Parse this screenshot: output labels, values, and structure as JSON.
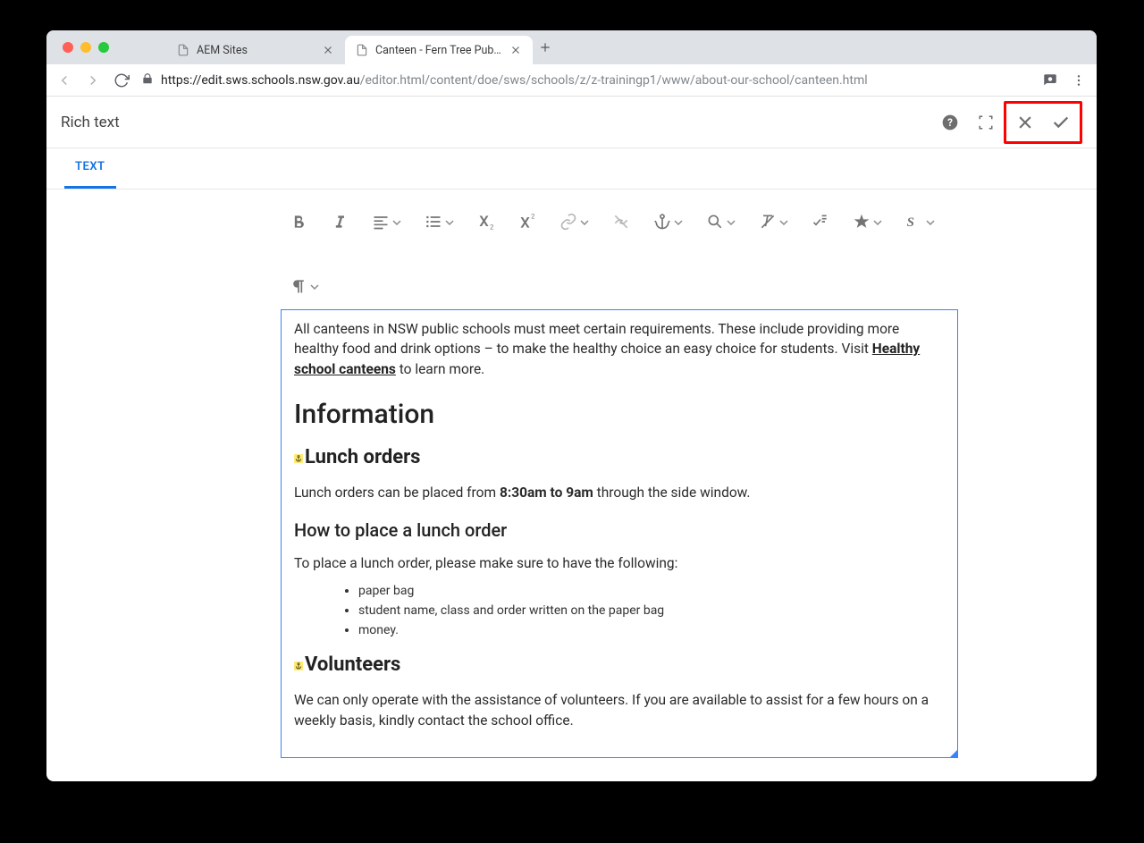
{
  "tabs": [
    {
      "title": "AEM Sites",
      "active": false
    },
    {
      "title": "Canteen - Fern Tree Public Sch",
      "active": true
    }
  ],
  "url": {
    "host": "https://edit.sws.schools.nsw.gov.au",
    "path": "/editor.html/content/doe/sws/schools/z/z-trainingp1/www/about-our-school/canteen.html"
  },
  "dialog": {
    "title": "Rich text"
  },
  "tabrow": {
    "label": "TEXT"
  },
  "content": {
    "intro1": "All canteens in NSW public schools must meet certain requirements. These include providing more healthy food and drink options – to make the healthy choice an easy choice for students. Visit ",
    "link": "Healthy school canteens",
    "intro2": " to learn more.",
    "h1": "Information",
    "h2a": "Lunch orders",
    "p1a": "Lunch orders can be placed from ",
    "p1b": "8:30am to 9am",
    "p1c": " through the side window.",
    "h3": "How to place a lunch order",
    "p2": "To place a lunch order, please make sure to have the following:",
    "li1": "paper bag",
    "li2": "student name, class and order written on the paper bag",
    "li3": "money.",
    "h2b": "Volunteers",
    "p3": "We can only operate with the assistance of volunteers. If you are available to assist for a few hours on a weekly basis, kindly contact the school office."
  }
}
